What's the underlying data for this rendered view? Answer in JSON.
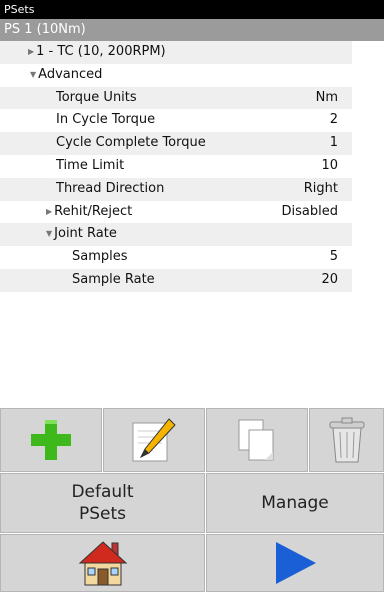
{
  "window": {
    "title": "PSets"
  },
  "pset": {
    "name": "PS 1 (10Nm)"
  },
  "tree": {
    "step": {
      "label": "1 - TC (10, 200RPM)"
    },
    "advanced": {
      "label": "Advanced"
    },
    "params": [
      {
        "label": "Torque Units",
        "value": "Nm"
      },
      {
        "label": "In Cycle Torque",
        "value": "2"
      },
      {
        "label": "Cycle Complete Torque",
        "value": "1"
      },
      {
        "label": "Time Limit",
        "value": "10"
      },
      {
        "label": "Thread Direction",
        "value": "Right"
      }
    ],
    "rehit": {
      "label": "Rehit/Reject",
      "value": "Disabled"
    },
    "joint_rate": {
      "label": "Joint Rate",
      "samples": {
        "label": "Samples",
        "value": "5"
      },
      "sample_rate": {
        "label": "Sample Rate",
        "value": "20"
      }
    }
  },
  "toolbar": {
    "add_icon": "plus-icon",
    "edit_icon": "pencil-icon",
    "copy_icon": "copy-icon",
    "delete_icon": "trash-icon"
  },
  "buttons": {
    "default_psets": {
      "line1": "Default",
      "line2": "PSets"
    },
    "manage": "Manage"
  },
  "nav": {
    "home_icon": "home-icon",
    "run_icon": "play-icon"
  },
  "colors": {
    "accent_blue": "#1a5fd6",
    "add_green": "#3fb81b",
    "header_gray": "#9b9b9b"
  }
}
